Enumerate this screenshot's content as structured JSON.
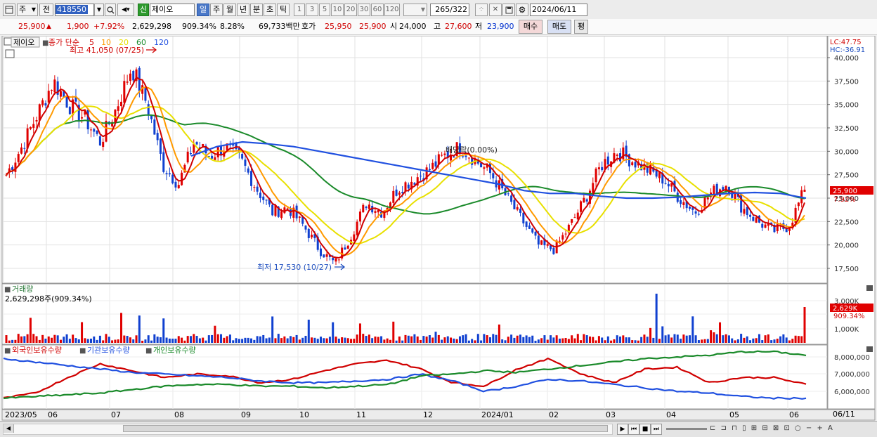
{
  "toolbar": {
    "market_label": "주",
    "type_label": "전",
    "code": "418550",
    "new_badge": "신",
    "name": "제이오",
    "periods": [
      "일",
      "주",
      "월",
      "년",
      "분",
      "초",
      "틱"
    ],
    "selected_period": "일",
    "intervals": [
      "1",
      "3",
      "5",
      "10",
      "20",
      "30",
      "60",
      "120"
    ],
    "range_value": "265",
    "range_total": "/322",
    "date": "2024/06/11"
  },
  "quote": {
    "price": "25,900",
    "change": "1,900",
    "change_pct": "+7.92%",
    "volume": "2,629,298",
    "vol_ratio": "909.34%",
    "turnover": "8.28%",
    "amount": "69,733백만",
    "bid_label": "호가",
    "bid1": "25,950",
    "bid2": "25,900",
    "open_label": "시",
    "open": "24,000",
    "high_label": "고",
    "high": "27,600",
    "low_label": "저",
    "low": "23,900",
    "buy_label": "매수",
    "sell_label": "매도",
    "eval_label": "평"
  },
  "price_panel": {
    "name_tab": "제이오",
    "legend_prefix": "종가 단순",
    "legend_items": [
      {
        "label": "5",
        "color": "#d00000"
      },
      {
        "label": "10",
        "color": "#ff9a00"
      },
      {
        "label": "20",
        "color": "#e8e000"
      },
      {
        "label": "60",
        "color": "#1a8a2a"
      },
      {
        "label": "120",
        "color": "#2050e0"
      }
    ],
    "high_label": "최고 41,050 (07/25)",
    "low_label": "최저 17,530 (10/27)",
    "ex_label": "배당락(0.00%)",
    "lc_label": "LC:47.75",
    "hc_label": "HC:-36.91",
    "price_tag": "25,900",
    "pct_tag": "7.92%",
    "y_ticks": [
      "40,000",
      "37,500",
      "35,000",
      "32,500",
      "30,000",
      "27,500",
      "25,000",
      "22,500",
      "20,000",
      "17,500"
    ]
  },
  "volume_panel": {
    "title": "거래량",
    "info": "2,629,298주(909.34%)",
    "y_ticks": [
      "3,000K",
      "1,000K"
    ],
    "tag": "2,629K",
    "tag2": "909.34%"
  },
  "flow_panel": {
    "legend": [
      {
        "label": "외국인보유수량",
        "color": "#d00000"
      },
      {
        "label": "기관보유수량",
        "color": "#2050e0"
      },
      {
        "label": "개인보유수량",
        "color": "#1a8a2a"
      }
    ],
    "y_ticks": [
      "8,000,000",
      "7,000,000",
      "6,000,000"
    ]
  },
  "x_axis": {
    "labels": [
      "2023/05",
      "06",
      "07",
      "08",
      "09",
      "10",
      "11",
      "12",
      "2024/01",
      "02",
      "03",
      "04",
      "05",
      "06"
    ],
    "right_label": "06/11"
  },
  "chart_data": {
    "type": "candlestick",
    "title": "제이오",
    "x_range": [
      "2023/05",
      "2024/06/11"
    ],
    "ylim": [
      16000,
      42000
    ],
    "price_curve": [
      27500,
      30500,
      34000,
      37500,
      35000,
      33500,
      31000,
      34500,
      39000,
      35000,
      28500,
      26500,
      31000,
      29500,
      30500,
      29000,
      26000,
      23500,
      24000,
      22000,
      19500,
      18000,
      21000,
      24500,
      23500,
      26000,
      27000,
      28000,
      29500,
      30500,
      29000,
      27500,
      25000,
      22500,
      20000,
      19500,
      22000,
      25000,
      28500,
      30000,
      29000,
      28000,
      27000,
      25000,
      23500,
      25500,
      26500,
      24000,
      22500,
      21500,
      22000,
      25900
    ],
    "ma120_curve": [
      29500,
      30500,
      31000,
      30800,
      30500,
      30000,
      29500,
      29000,
      28500,
      28000,
      27500,
      27000,
      26500,
      25800,
      25500,
      25500,
      25200,
      25000,
      25000,
      25100,
      25300,
      25500,
      25600,
      25500,
      25000
    ],
    "events": [
      {
        "label": "최고",
        "value": 41050,
        "date": "07/25"
      },
      {
        "label": "최저",
        "value": 17530,
        "date": "10/27"
      },
      {
        "label": "배당락",
        "value": "0.00%"
      }
    ],
    "last": {
      "price": 25900,
      "change_pct": 7.92,
      "volume": 2629298
    },
    "flow_series": [
      {
        "name": "외국인보유수량",
        "values": [
          5600000,
          5900000,
          6800000,
          7600000,
          7200000,
          6800000,
          7000000,
          6900000,
          6500000,
          6700000,
          7200000,
          7600000,
          7800000,
          7300000,
          6500000,
          6300000,
          7300000,
          7900000,
          7000000,
          6500000,
          7300000,
          7400000,
          6500000,
          6800000,
          6800000,
          6400000
        ]
      },
      {
        "name": "기관보유수량",
        "values": [
          7900000,
          7700000,
          7500000,
          7300000,
          7100000,
          7000000,
          6900000,
          6800000,
          6600000,
          6500000,
          6500000,
          6600000,
          6700000,
          7000000,
          6600000,
          6000000,
          6300000,
          6700000,
          6600000,
          6400000,
          6200000,
          6000000,
          5900000,
          5700000,
          5600000,
          5600000
        ]
      },
      {
        "name": "개인보유수량",
        "values": [
          5600000,
          5700000,
          5800000,
          5900000,
          6100000,
          6300000,
          6400000,
          6400000,
          6300000,
          6300000,
          6200000,
          6300000,
          6400000,
          6900000,
          7000000,
          7200000,
          7100000,
          7300000,
          7500000,
          7700000,
          7900000,
          8000000,
          8100000,
          8300000,
          8300000,
          8100000
        ]
      }
    ]
  }
}
